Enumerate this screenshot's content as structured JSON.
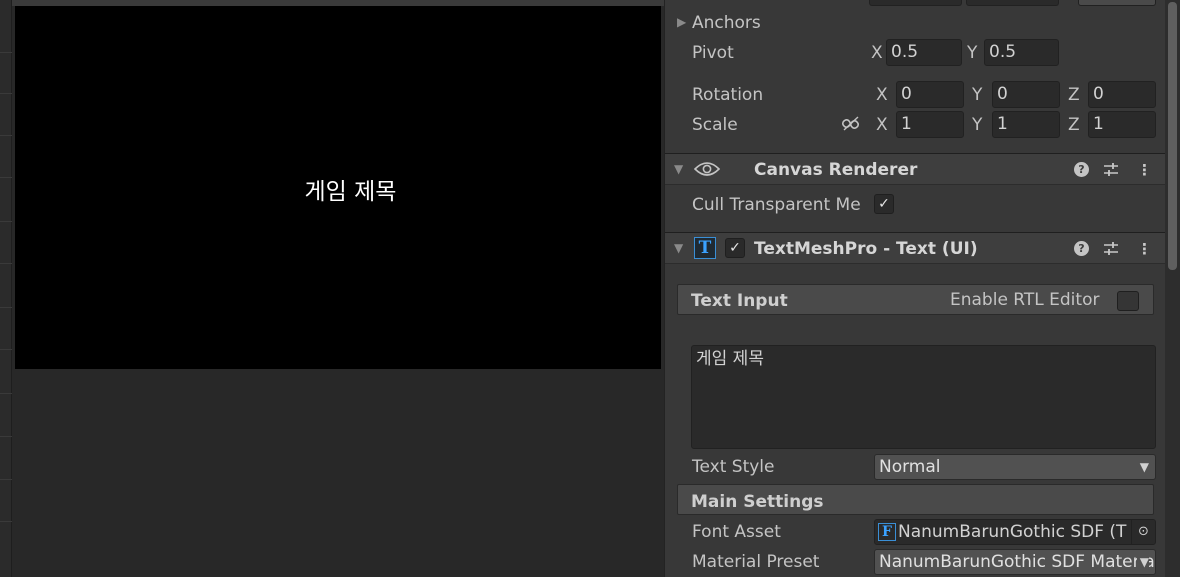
{
  "game_view": {
    "title_text": "게임 제목"
  },
  "rect_transform": {
    "anchors_label": "Anchors",
    "pivot_label": "Pivot",
    "pivot": {
      "x_axis": "X",
      "x": "0.5",
      "y_axis": "Y",
      "y": "0.5"
    },
    "rotation_label": "Rotation",
    "rotation": {
      "x_axis": "X",
      "x": "0",
      "y_axis": "Y",
      "y": "0",
      "z_axis": "Z",
      "z": "0"
    },
    "scale_label": "Scale",
    "scale": {
      "x_axis": "X",
      "x": "1",
      "y_axis": "Y",
      "y": "1",
      "z_axis": "Z",
      "z": "1"
    }
  },
  "canvas_renderer": {
    "title": "Canvas Renderer",
    "cull_label": "Cull Transparent Me",
    "cull_checked": true
  },
  "textmeshpro": {
    "title": "TextMeshPro - Text (UI)",
    "enabled": true,
    "text_input_section": "Text Input",
    "rtl_label": "Enable RTL Editor",
    "text_value": "게임 제목",
    "text_style_label": "Text Style",
    "text_style_value": "Normal",
    "main_settings_section": "Main Settings",
    "font_asset_label": "Font Asset",
    "font_asset_value": "NanumBarunGothic SDF (T",
    "material_preset_label": "Material Preset",
    "material_preset_value": "NanumBarunGothic SDF Materia"
  },
  "colors": {
    "inspector_bg": "#383838",
    "game_bg": "#000000",
    "scene_bg": "#282828",
    "tmp_icon_blue": "#3ba2ff"
  },
  "icons": {
    "help": "help-icon",
    "presets": "sliders-icon",
    "more": "kebab-menu-icon",
    "visibility": "eye-icon",
    "scale_lock": "unlinked-chain-icon",
    "picker": "object-picker-icon"
  }
}
